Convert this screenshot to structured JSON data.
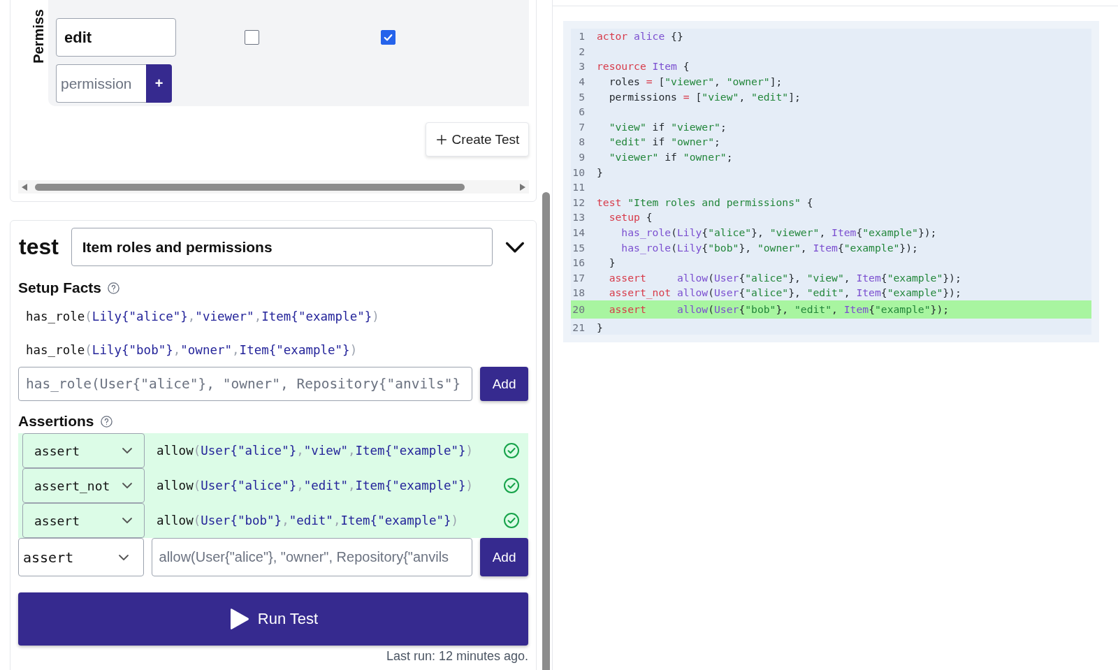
{
  "permissions_matrix": {
    "label": "Permiss",
    "rows": [
      {
        "name": "edit",
        "checks": [
          false,
          true
        ]
      }
    ],
    "new_permission": {
      "placeholder": "permission",
      "add_button": "+"
    }
  },
  "create_test_button": "Create Test",
  "test": {
    "label": "test",
    "name": "Item roles and permissions",
    "setup_facts": {
      "title": "Setup Facts",
      "facts": [
        [
          {
            "kind": "fn",
            "text": "has_role"
          },
          {
            "kind": "punct",
            "text": "("
          },
          {
            "kind": "val",
            "text": "Lily{\"alice\"}"
          },
          {
            "kind": "punct",
            "text": ","
          },
          {
            "kind": "val",
            "text": "\"viewer\""
          },
          {
            "kind": "punct",
            "text": ","
          },
          {
            "kind": "val",
            "text": "Item{\"example\"}"
          },
          {
            "kind": "punct",
            "text": ")"
          }
        ],
        [
          {
            "kind": "fn",
            "text": "has_role"
          },
          {
            "kind": "punct",
            "text": "("
          },
          {
            "kind": "val",
            "text": "Lily{\"bob\"}"
          },
          {
            "kind": "punct",
            "text": ","
          },
          {
            "kind": "val",
            "text": "\"owner\""
          },
          {
            "kind": "punct",
            "text": ","
          },
          {
            "kind": "val",
            "text": "Item{\"example\"}"
          },
          {
            "kind": "punct",
            "text": ")"
          }
        ]
      ],
      "input": {
        "placeholder": "has_role(User{\"alice\"}, \"owner\", Repository{\"anvils\"}"
      },
      "add_button": "Add"
    },
    "assertions": {
      "title": "Assertions",
      "rows": [
        {
          "type": "assert",
          "passed": true,
          "expression": [
            {
              "kind": "fn",
              "text": "allow"
            },
            {
              "kind": "punct",
              "text": "("
            },
            {
              "kind": "val",
              "text": "User{\"alice\"}"
            },
            {
              "kind": "punct",
              "text": ","
            },
            {
              "kind": "val",
              "text": "\"view\""
            },
            {
              "kind": "punct",
              "text": ","
            },
            {
              "kind": "val",
              "text": "Item{\"example\"}"
            },
            {
              "kind": "punct",
              "text": ")"
            }
          ]
        },
        {
          "type": "assert_not",
          "passed": true,
          "expression": [
            {
              "kind": "fn",
              "text": "allow"
            },
            {
              "kind": "punct",
              "text": "("
            },
            {
              "kind": "val",
              "text": "User{\"alice\"}"
            },
            {
              "kind": "punct",
              "text": ","
            },
            {
              "kind": "val",
              "text": "\"edit\""
            },
            {
              "kind": "punct",
              "text": ","
            },
            {
              "kind": "val",
              "text": "Item{\"example\"}"
            },
            {
              "kind": "punct",
              "text": ")"
            }
          ]
        },
        {
          "type": "assert",
          "passed": true,
          "expression": [
            {
              "kind": "fn",
              "text": "allow"
            },
            {
              "kind": "punct",
              "text": "("
            },
            {
              "kind": "val",
              "text": "User{\"bob\"}"
            },
            {
              "kind": "punct",
              "text": ","
            },
            {
              "kind": "val",
              "text": "\"edit\""
            },
            {
              "kind": "punct",
              "text": ","
            },
            {
              "kind": "val",
              "text": "Item{\"example\"}"
            },
            {
              "kind": "punct",
              "text": ")"
            }
          ]
        }
      ],
      "new": {
        "type": "assert",
        "placeholder": "allow(User{\"alice\"}, \"owner\", Repository{\"anvils",
        "add_button": "Add"
      }
    },
    "run_button": "Run Test",
    "last_run": "Last run: 12 minutes ago."
  },
  "editor": {
    "lines": [
      {
        "number": "1",
        "highlighted": false,
        "tokens": [
          {
            "kind": "kw",
            "text": "actor"
          },
          {
            "kind": "type",
            "text": " alice"
          },
          {
            "kind": "plain",
            "text": " {}"
          }
        ]
      },
      {
        "number": "2",
        "highlighted": false
      },
      {
        "number": "3",
        "highlighted": false,
        "tokens": [
          {
            "kind": "kw",
            "text": "resource"
          },
          {
            "kind": "type",
            "text": " Item"
          },
          {
            "kind": "plain",
            "text": " {"
          }
        ]
      },
      {
        "number": "4",
        "highlighted": false,
        "tokens": [
          {
            "kind": "plain",
            "text": "  roles "
          },
          {
            "kind": "op",
            "text": "="
          },
          {
            "kind": "plain",
            "text": " ["
          },
          {
            "kind": "str",
            "text": "\"viewer\""
          },
          {
            "kind": "plain",
            "text": ", "
          },
          {
            "kind": "str",
            "text": "\"owner\""
          },
          {
            "kind": "plain",
            "text": "];"
          }
        ]
      },
      {
        "number": "5",
        "highlighted": false,
        "tokens": [
          {
            "kind": "plain",
            "text": "  permissions "
          },
          {
            "kind": "op",
            "text": "="
          },
          {
            "kind": "plain",
            "text": " ["
          },
          {
            "kind": "str",
            "text": "\"view\""
          },
          {
            "kind": "plain",
            "text": ", "
          },
          {
            "kind": "str",
            "text": "\"edit\""
          },
          {
            "kind": "plain",
            "text": "];"
          }
        ]
      },
      {
        "number": "6",
        "highlighted": false
      },
      {
        "number": "7",
        "highlighted": false,
        "tokens": [
          {
            "kind": "str",
            "text": "  \"view\""
          },
          {
            "kind": "plain",
            "text": " if "
          },
          {
            "kind": "str",
            "text": "\"viewer\""
          },
          {
            "kind": "plain",
            "text": ";"
          }
        ]
      },
      {
        "number": "8",
        "highlighted": false,
        "tokens": [
          {
            "kind": "str",
            "text": "  \"edit\""
          },
          {
            "kind": "plain",
            "text": " if "
          },
          {
            "kind": "str",
            "text": "\"owner\""
          },
          {
            "kind": "plain",
            "text": ";"
          }
        ]
      },
      {
        "number": "9",
        "highlighted": false,
        "tokens": [
          {
            "kind": "str",
            "text": "  \"viewer\""
          },
          {
            "kind": "plain",
            "text": " if "
          },
          {
            "kind": "str",
            "text": "\"owner\""
          },
          {
            "kind": "plain",
            "text": ";"
          }
        ]
      },
      {
        "number": "10",
        "highlighted": false,
        "tokens": [
          {
            "kind": "plain",
            "text": "}"
          }
        ]
      },
      {
        "number": "11",
        "highlighted": false
      },
      {
        "number": "12",
        "highlighted": false,
        "tokens": [
          {
            "kind": "kw",
            "text": "test"
          },
          {
            "kind": "str",
            "text": " \"Item roles and permissions\""
          },
          {
            "kind": "plain",
            "text": " {"
          }
        ]
      },
      {
        "number": "13",
        "highlighted": false,
        "tokens": [
          {
            "kind": "kw",
            "text": "  setup"
          },
          {
            "kind": "plain",
            "text": " {"
          }
        ]
      },
      {
        "number": "14",
        "highlighted": false,
        "tokens": [
          {
            "kind": "type",
            "text": "    has_role"
          },
          {
            "kind": "plain",
            "text": "("
          },
          {
            "kind": "type",
            "text": "Lily"
          },
          {
            "kind": "plain",
            "text": "{"
          },
          {
            "kind": "str",
            "text": "\"alice\""
          },
          {
            "kind": "plain",
            "text": "}, "
          },
          {
            "kind": "str",
            "text": "\"viewer\""
          },
          {
            "kind": "plain",
            "text": ", "
          },
          {
            "kind": "type",
            "text": "Item"
          },
          {
            "kind": "plain",
            "text": "{"
          },
          {
            "kind": "str",
            "text": "\"example\""
          },
          {
            "kind": "plain",
            "text": "});"
          }
        ]
      },
      {
        "number": "15",
        "highlighted": false,
        "tokens": [
          {
            "kind": "type",
            "text": "    has_role"
          },
          {
            "kind": "plain",
            "text": "("
          },
          {
            "kind": "type",
            "text": "Lily"
          },
          {
            "kind": "plain",
            "text": "{"
          },
          {
            "kind": "str",
            "text": "\"bob\""
          },
          {
            "kind": "plain",
            "text": "}, "
          },
          {
            "kind": "str",
            "text": "\"owner\""
          },
          {
            "kind": "plain",
            "text": ", "
          },
          {
            "kind": "type",
            "text": "Item"
          },
          {
            "kind": "plain",
            "text": "{"
          },
          {
            "kind": "str",
            "text": "\"example\""
          },
          {
            "kind": "plain",
            "text": "});"
          }
        ]
      },
      {
        "number": "16",
        "highlighted": false,
        "tokens": [
          {
            "kind": "plain",
            "text": "  }"
          }
        ]
      },
      {
        "number": "17",
        "highlighted": false,
        "tokens": [
          {
            "kind": "kw",
            "text": "  assert"
          },
          {
            "kind": "type",
            "text": "     allow"
          },
          {
            "kind": "plain",
            "text": "("
          },
          {
            "kind": "type",
            "text": "User"
          },
          {
            "kind": "plain",
            "text": "{"
          },
          {
            "kind": "str",
            "text": "\"alice\""
          },
          {
            "kind": "plain",
            "text": "}, "
          },
          {
            "kind": "str",
            "text": "\"view\""
          },
          {
            "kind": "plain",
            "text": ", "
          },
          {
            "kind": "type",
            "text": "Item"
          },
          {
            "kind": "plain",
            "text": "{"
          },
          {
            "kind": "str",
            "text": "\"example\""
          },
          {
            "kind": "plain",
            "text": "});"
          }
        ]
      },
      {
        "number": "18",
        "highlighted": false,
        "tokens": [
          {
            "kind": "kw",
            "text": "  assert_not"
          },
          {
            "kind": "type",
            "text": " allow"
          },
          {
            "kind": "plain",
            "text": "("
          },
          {
            "kind": "type",
            "text": "User"
          },
          {
            "kind": "plain",
            "text": "{"
          },
          {
            "kind": "str",
            "text": "\"alice\""
          },
          {
            "kind": "plain",
            "text": "}, "
          },
          {
            "kind": "str",
            "text": "\"edit\""
          },
          {
            "kind": "plain",
            "text": ", "
          },
          {
            "kind": "type",
            "text": "Item"
          },
          {
            "kind": "plain",
            "text": "{"
          },
          {
            "kind": "str",
            "text": "\"example\""
          },
          {
            "kind": "plain",
            "text": "});"
          }
        ]
      },
      {
        "number": "20",
        "highlighted": true,
        "tokens": [
          {
            "kind": "kw",
            "text": "  assert"
          },
          {
            "kind": "type",
            "text": "     allow"
          },
          {
            "kind": "plain",
            "text": "("
          },
          {
            "kind": "type",
            "text": "User"
          },
          {
            "kind": "plain",
            "text": "{"
          },
          {
            "kind": "str",
            "text": "\"bob\""
          },
          {
            "kind": "plain",
            "text": "}, "
          },
          {
            "kind": "str",
            "text": "\"edit\""
          },
          {
            "kind": "plain",
            "text": ", "
          },
          {
            "kind": "type",
            "text": "Item"
          },
          {
            "kind": "plain",
            "text": "{"
          },
          {
            "kind": "str",
            "text": "\"example\""
          },
          {
            "kind": "plain",
            "text": "});"
          }
        ]
      },
      {
        "number": "21",
        "highlighted": false,
        "tokens": [
          {
            "kind": "plain",
            "text": "}"
          }
        ]
      }
    ]
  }
}
